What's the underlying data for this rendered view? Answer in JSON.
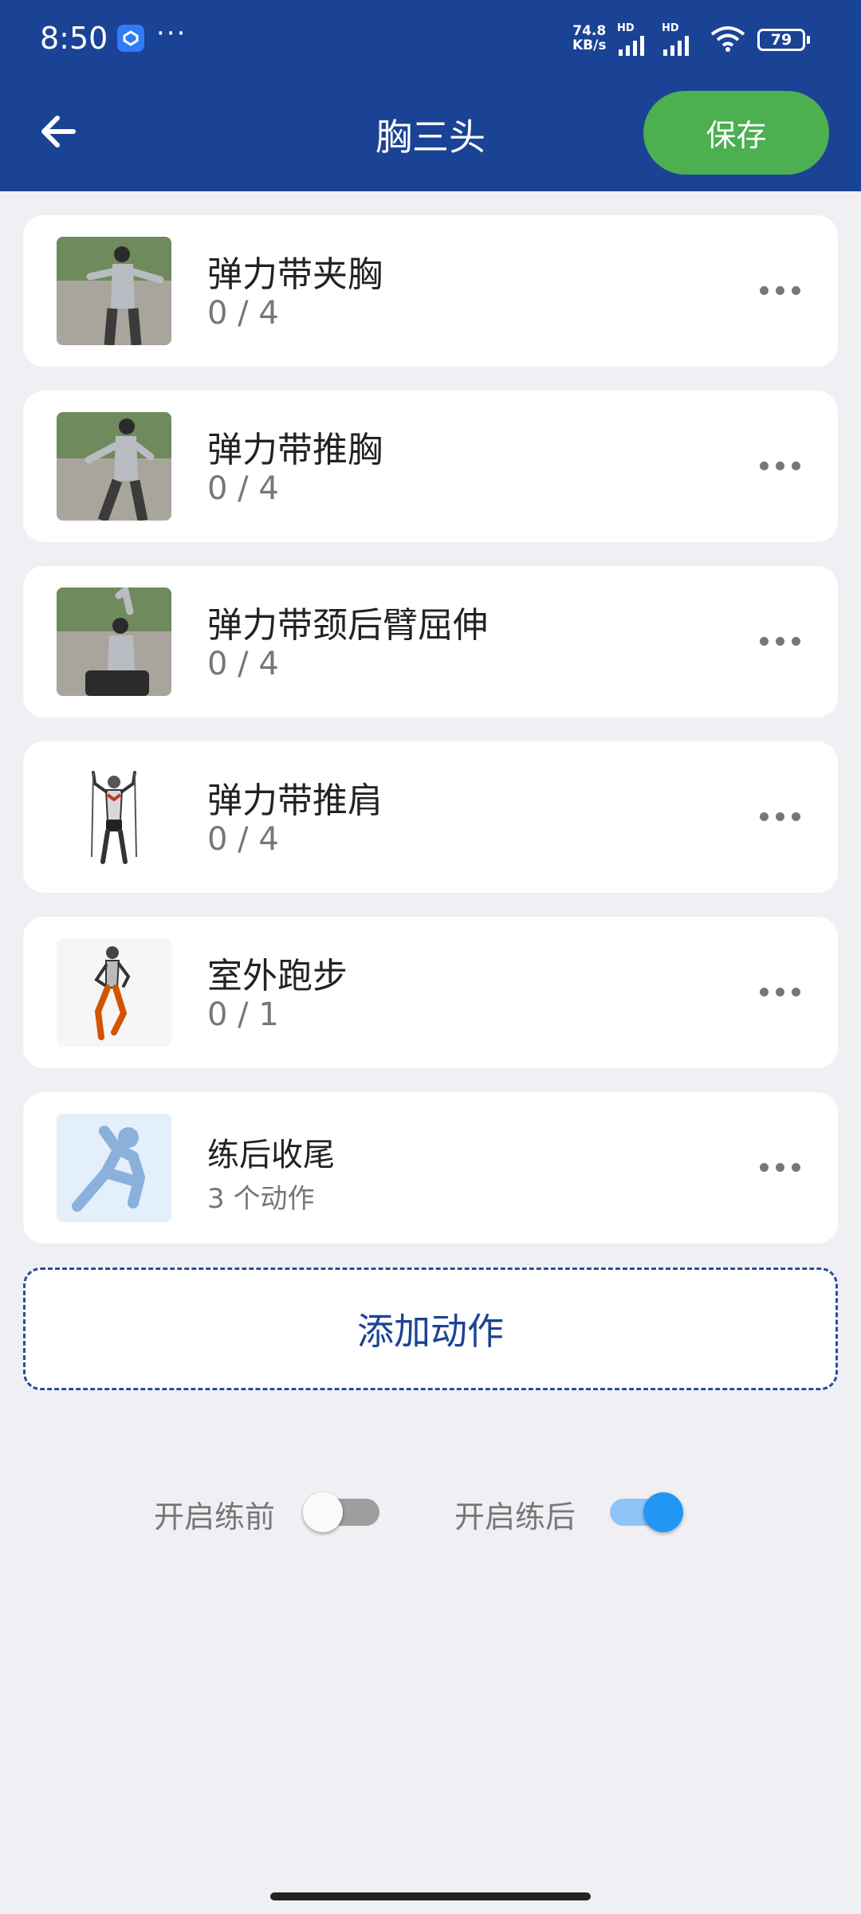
{
  "status_bar": {
    "time": "8:50",
    "more": "···",
    "net_speed_value": "74.8",
    "net_speed_unit": "KB/s",
    "sig1_tag": "HD",
    "sig2_tag": "HD",
    "battery": "79"
  },
  "header": {
    "title": "胸三头",
    "save_label": "保存",
    "color": "#1b4395",
    "save_color": "#4caf50"
  },
  "exercises": [
    {
      "name": "弹力带夹胸",
      "progress": "0 / 4"
    },
    {
      "name": "弹力带推胸",
      "progress": "0 / 4"
    },
    {
      "name": "弹力带颈后臂屈伸",
      "progress": "0 / 4"
    },
    {
      "name": "弹力带推肩",
      "progress": "0 / 4"
    },
    {
      "name": "室外跑步",
      "progress": "0 / 1"
    },
    {
      "name": "练后收尾",
      "progress": "3 个动作"
    }
  ],
  "add_action_label": "添加动作",
  "toggles": {
    "pre": {
      "label": "开启练前",
      "on": false
    },
    "post": {
      "label": "开启练后",
      "on": true
    }
  }
}
